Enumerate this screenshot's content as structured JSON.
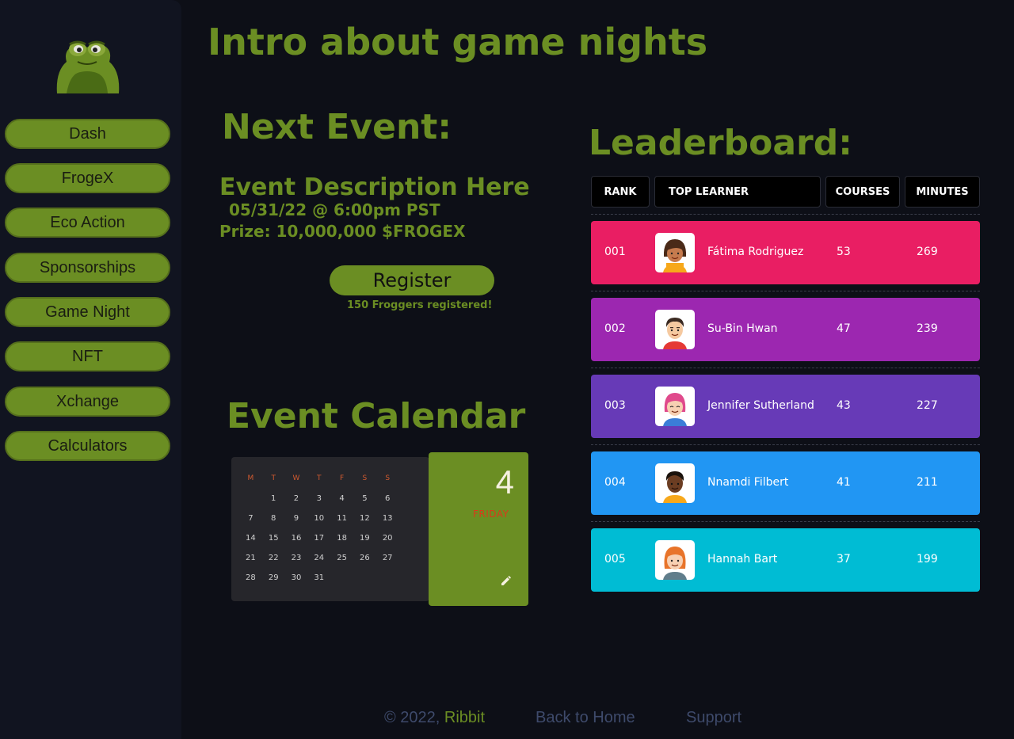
{
  "sidebar": {
    "logo_icon": "frog-logo",
    "items": [
      {
        "label": "Dash"
      },
      {
        "label": "FrogeX"
      },
      {
        "label": "Eco Action"
      },
      {
        "label": "Sponsorships"
      },
      {
        "label": "Game Night"
      },
      {
        "label": "NFT"
      },
      {
        "label": "Xchange"
      },
      {
        "label": "Calculators"
      }
    ]
  },
  "main": {
    "title": "Intro about game nights",
    "next_event": {
      "heading": "Next Event:",
      "description": "Event Description Here",
      "date": "05/31/22 @ 6:00pm PST",
      "prize": "Prize: 10,000,000 $FROGEX",
      "register_label": "Register",
      "registered_count": "150 Froggers registered!"
    },
    "calendar": {
      "heading": "Event Calendar",
      "weekdays": [
        "M",
        "T",
        "W",
        "T",
        "F",
        "S",
        "S"
      ],
      "weeks": [
        [
          "",
          "1",
          "2",
          "3",
          "4",
          "5",
          "6"
        ],
        [
          "7",
          "8",
          "9",
          "10",
          "11",
          "12",
          "13"
        ],
        [
          "14",
          "15",
          "16",
          "17",
          "18",
          "19",
          "20"
        ],
        [
          "21",
          "22",
          "23",
          "24",
          "25",
          "26",
          "27"
        ],
        [
          "28",
          "29",
          "30",
          "31",
          "",
          "",
          ""
        ]
      ],
      "selected_day": "4",
      "selected_weekday": "FRIDAY",
      "edit_icon": "pencil-icon"
    },
    "leaderboard": {
      "heading": "Leaderboard:",
      "columns": {
        "rank": "RANK",
        "learner": "TOP LEARNER",
        "courses": "COURSES",
        "minutes": "MINUTES"
      },
      "rows": [
        {
          "rank": "001",
          "name": "Fátima Rodriguez",
          "courses": "53",
          "minutes": "269",
          "color": "#e91e63",
          "avatar_icon": "avatar-woman-brown-hair"
        },
        {
          "rank": "002",
          "name": "Su-Bin Hwan",
          "courses": "47",
          "minutes": "239",
          "color": "#9c27b0",
          "avatar_icon": "avatar-man-dark-hair"
        },
        {
          "rank": "003",
          "name": "Jennifer Sutherland",
          "courses": "43",
          "minutes": "227",
          "color": "#673ab7",
          "avatar_icon": "avatar-woman-pink-hair"
        },
        {
          "rank": "004",
          "name": "Nnamdi Filbert",
          "courses": "41",
          "minutes": "211",
          "color": "#2196f3",
          "avatar_icon": "avatar-man-dark-skin"
        },
        {
          "rank": "005",
          "name": "Hannah Bart",
          "courses": "37",
          "minutes": "199",
          "color": "#00bcd4",
          "avatar_icon": "avatar-woman-orange-hair"
        }
      ]
    }
  },
  "footer": {
    "copyright": "© 2022, ",
    "brand": "Ribbit",
    "back_home": "Back to Home",
    "support": "Support"
  },
  "colors": {
    "accent": "#6b8e23",
    "background": "#0d0f17",
    "sidebar": "#111420"
  }
}
